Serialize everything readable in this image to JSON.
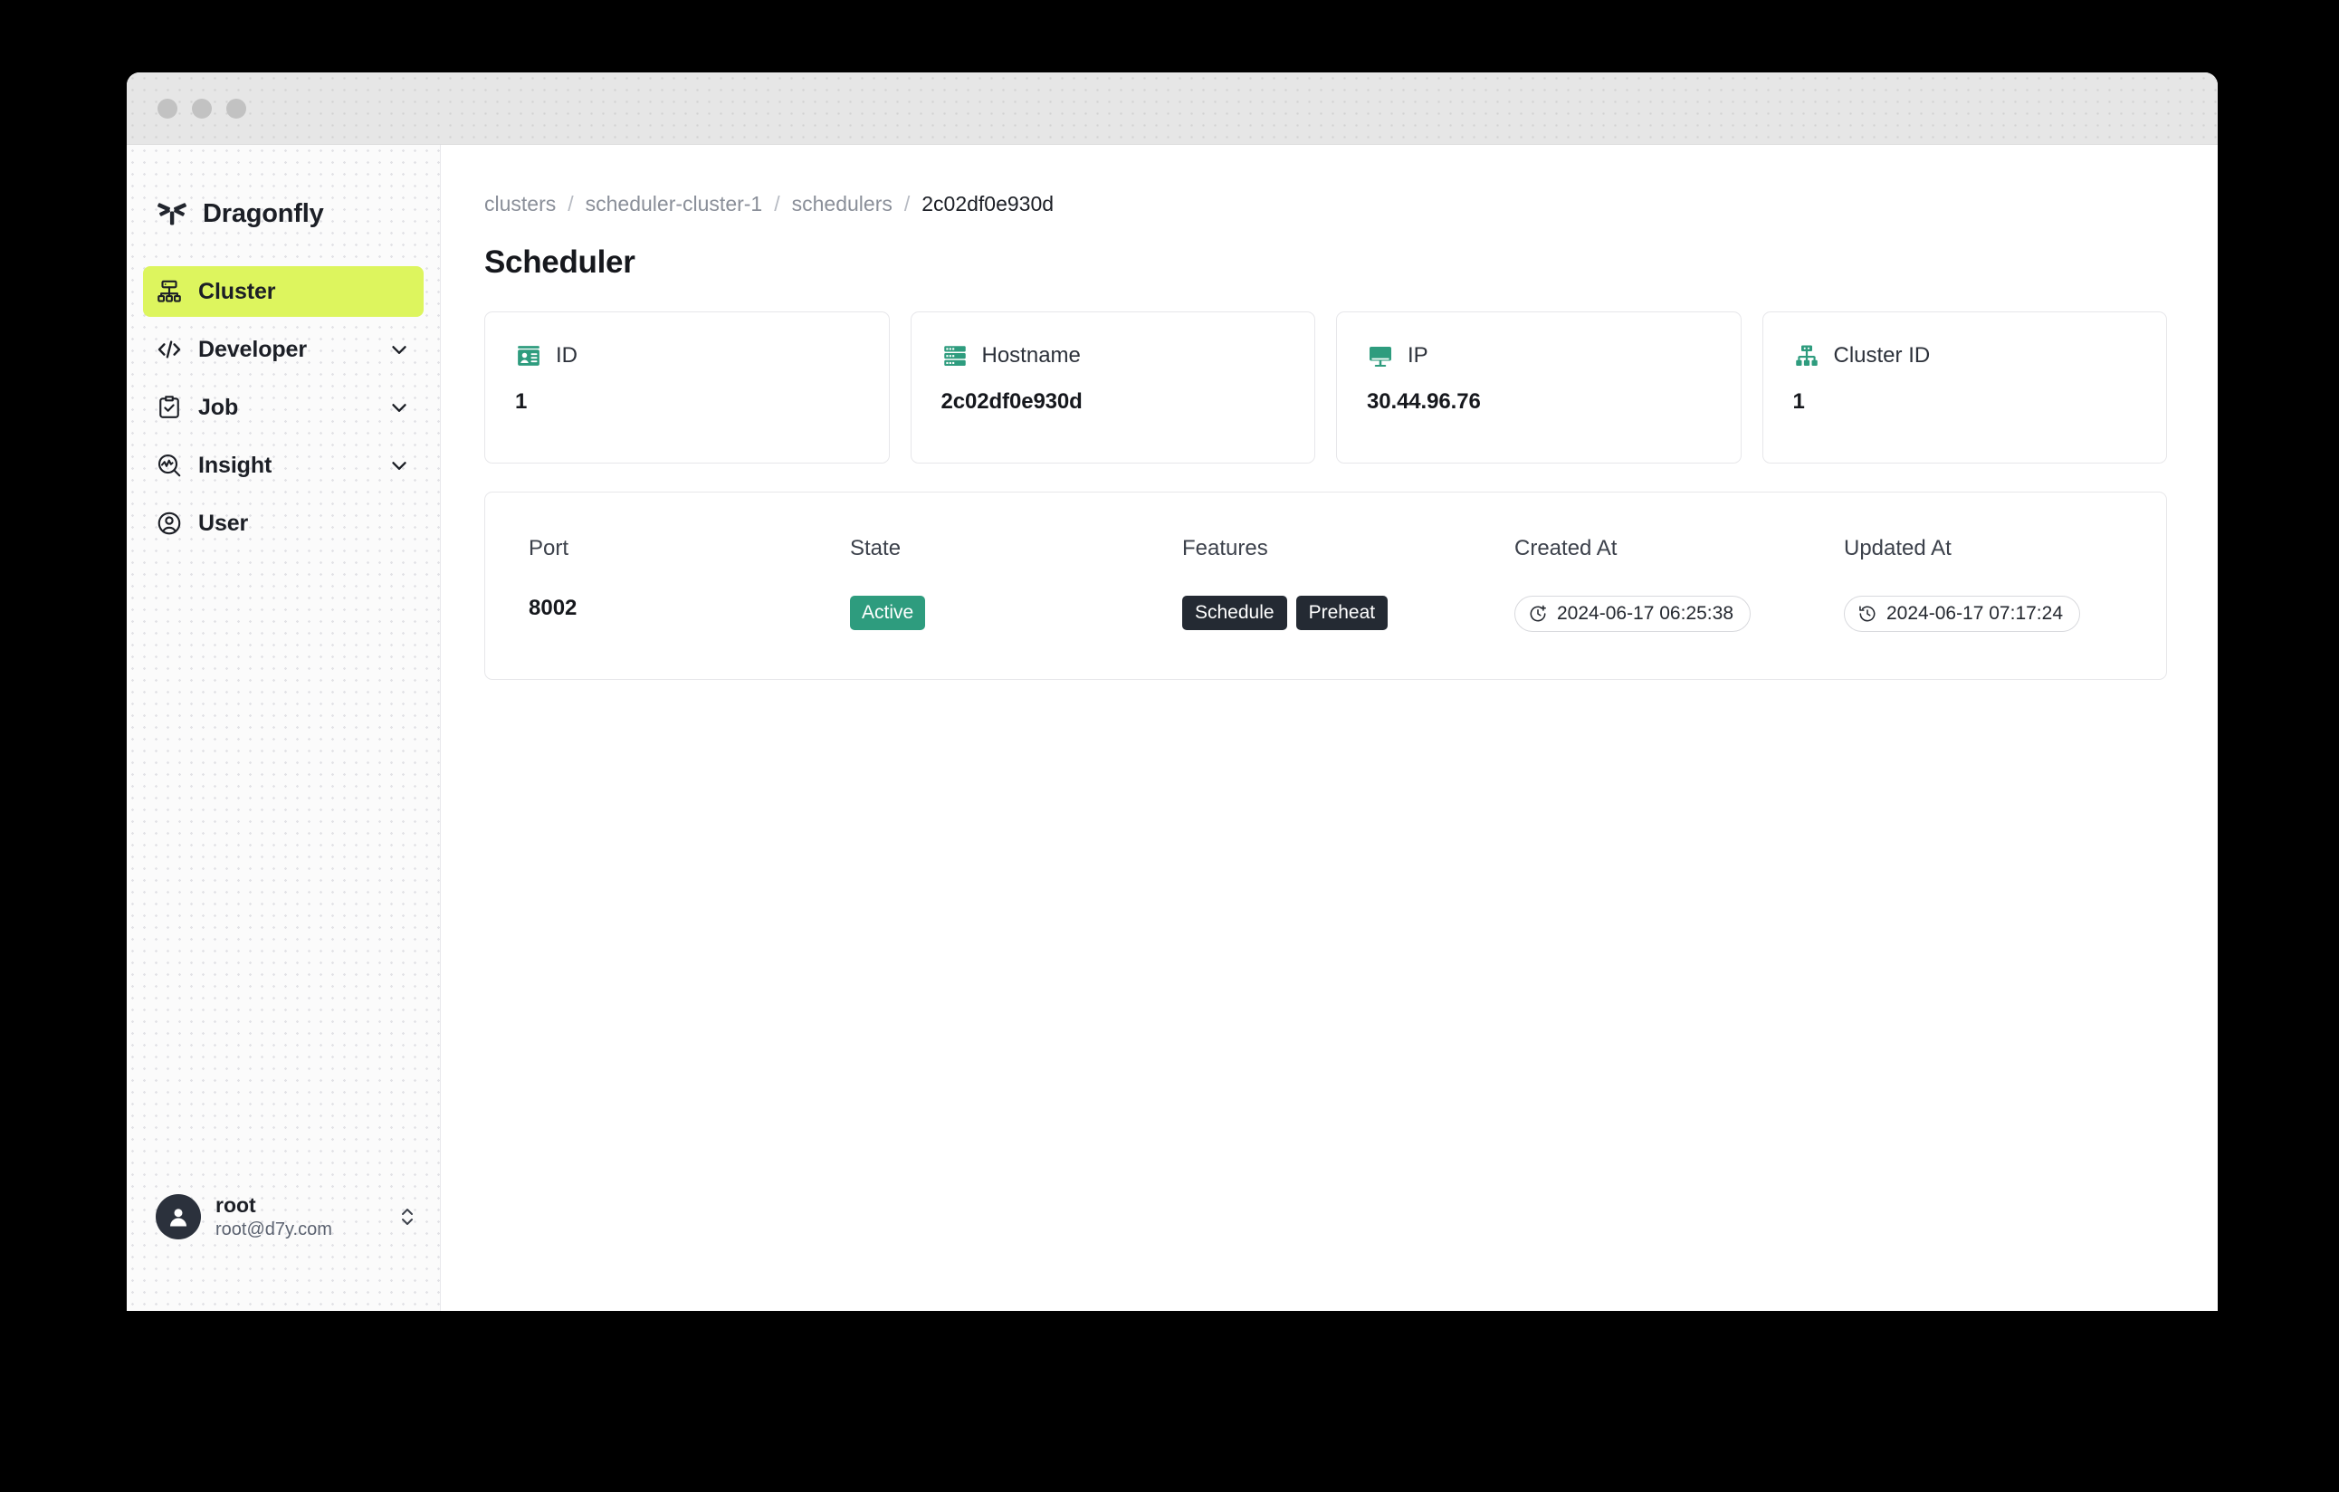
{
  "window": {
    "traffic_lights": [
      "close",
      "minimize",
      "maximize"
    ]
  },
  "sidebar": {
    "brand": {
      "name": "Dragonfly",
      "logo_icon": "dragonfly-logo-icon"
    },
    "items": [
      {
        "label": "Cluster",
        "icon": "cluster-icon",
        "active": true,
        "expandable": false
      },
      {
        "label": "Developer",
        "icon": "code-icon",
        "active": false,
        "expandable": true
      },
      {
        "label": "Job",
        "icon": "clipboard-check-icon",
        "active": false,
        "expandable": true
      },
      {
        "label": "Insight",
        "icon": "insight-search-icon",
        "active": false,
        "expandable": true
      },
      {
        "label": "User",
        "icon": "user-circle-icon",
        "active": false,
        "expandable": false
      }
    ],
    "active_color": "#ddf55e",
    "user": {
      "name": "root",
      "email": "root@d7y.com",
      "avatar_icon": "avatar-icon",
      "switcher_icon": "chevron-up-down-icon"
    }
  },
  "main": {
    "breadcrumb": [
      {
        "label": "clusters",
        "current": false
      },
      {
        "label": "scheduler-cluster-1",
        "current": false
      },
      {
        "label": "schedulers",
        "current": false
      },
      {
        "label": "2c02df0e930d",
        "current": true
      }
    ],
    "breadcrumb_separator": "/",
    "page_title": "Scheduler",
    "cards": [
      {
        "label": "ID",
        "value": "1",
        "icon": "id-card-icon"
      },
      {
        "label": "Hostname",
        "value": "2c02df0e930d",
        "icon": "server-rack-icon"
      },
      {
        "label": "IP",
        "value": "30.44.96.76",
        "icon": "monitor-icon"
      },
      {
        "label": "Cluster ID",
        "value": "1",
        "icon": "cluster-nodes-icon"
      }
    ],
    "icon_accent_color": "#2e9c7e",
    "detail": {
      "columns": [
        "Port",
        "State",
        "Features",
        "Created At",
        "Updated At"
      ],
      "port": "8002",
      "state": {
        "label": "Active",
        "color": "#2e9c7e"
      },
      "features": [
        {
          "label": "Schedule",
          "color": "#242a33"
        },
        {
          "label": "Preheat",
          "color": "#242a33"
        }
      ],
      "created_at": {
        "value": "2024-06-17 06:25:38",
        "icon": "clock-plus-icon"
      },
      "updated_at": {
        "value": "2024-06-17 07:17:24",
        "icon": "clock-history-icon"
      }
    }
  }
}
